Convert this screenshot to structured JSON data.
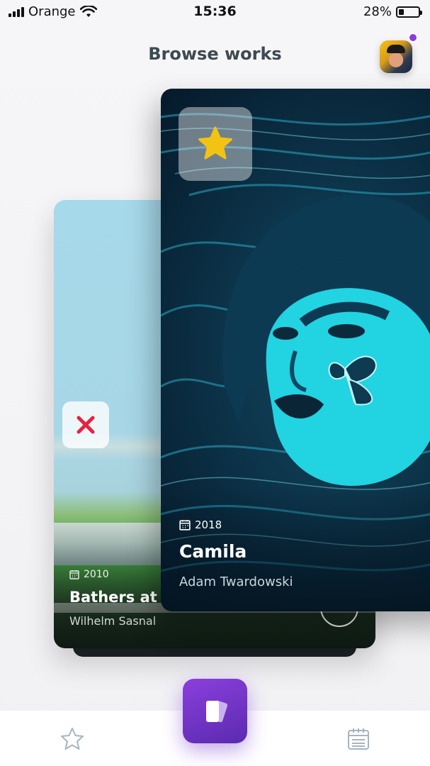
{
  "status_bar": {
    "carrier": "Orange",
    "time": "15:36",
    "battery": "28%",
    "battery_level": 0.28,
    "signal_icon": "signal-bars-icon",
    "wifi_icon": "wifi-icon"
  },
  "header": {
    "title": "Browse works",
    "avatar_icon": "user-avatar",
    "notification_color": "#8a3ddb"
  },
  "cards": {
    "front": {
      "year": "2018",
      "title": "Camila",
      "artist": "Adam Twardowski",
      "action_icon": "star-icon",
      "action_color": "#f3c313"
    },
    "back": {
      "year": "2010",
      "title": "Bathers at A",
      "artist": "Wilhelm Sasnal",
      "action_icon": "close-icon",
      "action_color": "#e8213d"
    }
  },
  "tab_bar": {
    "items": [
      {
        "icon": "star-outline-icon"
      },
      {
        "icon": "cards-icon",
        "active": true
      },
      {
        "icon": "calendar-icon"
      }
    ],
    "accent_color": "#7a34d1"
  }
}
